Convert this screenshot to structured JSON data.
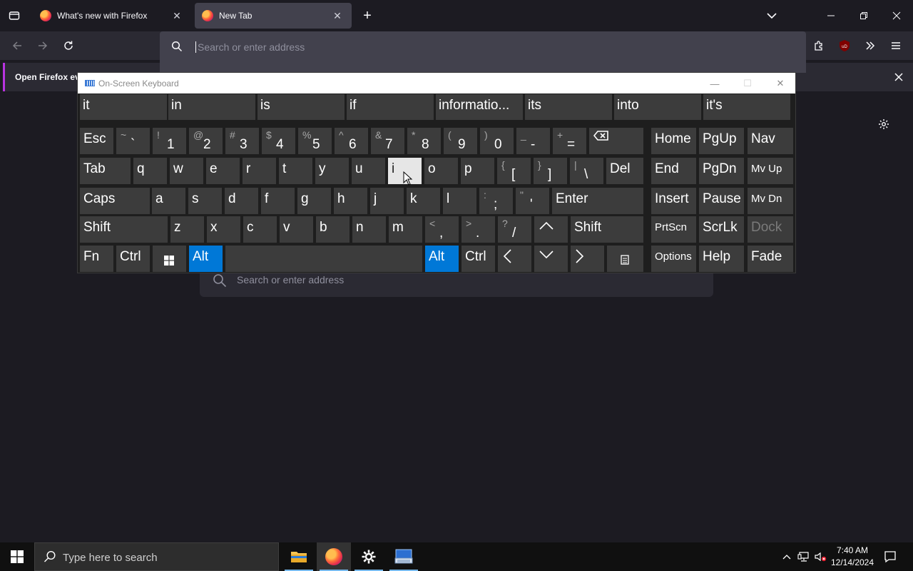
{
  "browser": {
    "tabs": [
      {
        "title": "What's new with Firefox",
        "active": false
      },
      {
        "title": "New Tab",
        "active": true
      }
    ],
    "urlbar": {
      "placeholder": "Search or enter address"
    },
    "notification": {
      "text": "Open Firefox ev"
    }
  },
  "new_tab": {
    "search_placeholder": "Search or enter address"
  },
  "osk": {
    "title": "On-Screen Keyboard",
    "predictions": [
      "it",
      "in",
      "is",
      "if",
      "informatio...",
      "its",
      "into",
      "it's"
    ],
    "row_numbers": {
      "esc": "Esc",
      "keys": [
        {
          "shift": "~",
          "main": "`"
        },
        {
          "shift": "!",
          "main": "1"
        },
        {
          "shift": "@",
          "main": "2"
        },
        {
          "shift": "#",
          "main": "3"
        },
        {
          "shift": "$",
          "main": "4"
        },
        {
          "shift": "%",
          "main": "5"
        },
        {
          "shift": "^",
          "main": "6"
        },
        {
          "shift": "&",
          "main": "7"
        },
        {
          "shift": "*",
          "main": "8"
        },
        {
          "shift": "(",
          "main": "9"
        },
        {
          "shift": ")",
          "main": "0"
        },
        {
          "shift": "_",
          "main": "-"
        },
        {
          "shift": "+",
          "main": "="
        }
      ],
      "backspace": "⌫",
      "home": "Home",
      "pgup": "PgUp",
      "nav": "Nav"
    },
    "row_q": {
      "tab": "Tab",
      "letters": [
        "q",
        "w",
        "e",
        "r",
        "t",
        "y",
        "u",
        "i",
        "o",
        "p"
      ],
      "brackets": [
        {
          "shift": "{",
          "main": "["
        },
        {
          "shift": "}",
          "main": "]"
        },
        {
          "shift": "|",
          "main": "\\"
        }
      ],
      "del": "Del",
      "end": "End",
      "pgdn": "PgDn",
      "mvup": "Mv Up"
    },
    "row_a": {
      "caps": "Caps",
      "letters": [
        "a",
        "s",
        "d",
        "f",
        "g",
        "h",
        "j",
        "k",
        "l"
      ],
      "punct": [
        {
          "shift": ":",
          "main": ";"
        },
        {
          "shift": "\"",
          "main": "'"
        }
      ],
      "enter": "Enter",
      "insert": "Insert",
      "pause": "Pause",
      "mvdn": "Mv Dn"
    },
    "row_z": {
      "shift_left": "Shift",
      "letters": [
        "z",
        "x",
        "c",
        "v",
        "b",
        "n",
        "m"
      ],
      "punct": [
        {
          "shift": "<",
          "main": ","
        },
        {
          "shift": ">",
          "main": "."
        },
        {
          "shift": "?",
          "main": "/"
        }
      ],
      "up": "^",
      "shift_right": "Shift",
      "prtscn": "PrtScn",
      "scrlk": "ScrLk",
      "dock": "Dock"
    },
    "row_bottom": {
      "fn": "Fn",
      "ctrl_left": "Ctrl",
      "alt_left": "Alt",
      "alt_right": "Alt",
      "ctrl_right": "Ctrl",
      "options": "Options",
      "help": "Help",
      "fade": "Fade"
    },
    "pressed_key": "i"
  },
  "taskbar": {
    "search_placeholder": "Type here to search",
    "time": "7:40 AM",
    "date": "12/14/2024"
  },
  "colors": {
    "accent_blue": "#0078d7",
    "osk_key": "#3c3c3c",
    "tab_active": "#42414d"
  }
}
